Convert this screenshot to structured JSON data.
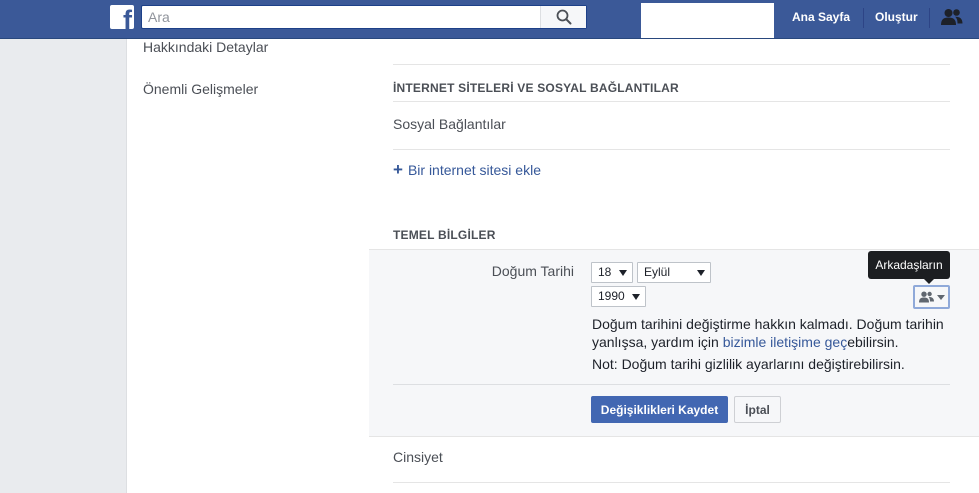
{
  "topbar": {
    "logo": "f",
    "search_placeholder": "Ara",
    "nav": {
      "home": "Ana Sayfa",
      "create": "Oluştur"
    },
    "icons": {
      "search": "search-icon",
      "friends": "friend-requests-icon"
    }
  },
  "sidebar": {
    "items": [
      {
        "label": "Hakkındaki Detaylar"
      },
      {
        "label": "Önemli Gelişmeler"
      }
    ]
  },
  "main": {
    "websites_header": "İNTERNET SİTELERİ VE SOSYAL BAĞLANTILAR",
    "social_links_label": "Sosyal Bağlantılar",
    "add_website_label": "Bir internet sitesi ekle",
    "basic_info_header": "TEMEL BİLGİLER",
    "birthday": {
      "label": "Doğum Tarihi",
      "day": "18",
      "month": "Eylül",
      "year": "1990",
      "privacy_tooltip": "Arkadaşların",
      "note_part1": "Doğum tarihini değiştirme hakkın kalmadı. Doğum tarihin yanlışsa, yardım için ",
      "note_link": "bizimle iletişime geç",
      "note_part2": "ebilirsin.",
      "note2": "Not: Doğum tarihi gizlilik ayarlarını değiştirebilirsin.",
      "save_label": "Değişiklikleri Kaydet",
      "cancel_label": "İptal"
    },
    "gender_label": "Cinsiyet"
  },
  "colors": {
    "brand": "#3b5998",
    "primary_button": "#4267b2",
    "link": "#365899"
  }
}
